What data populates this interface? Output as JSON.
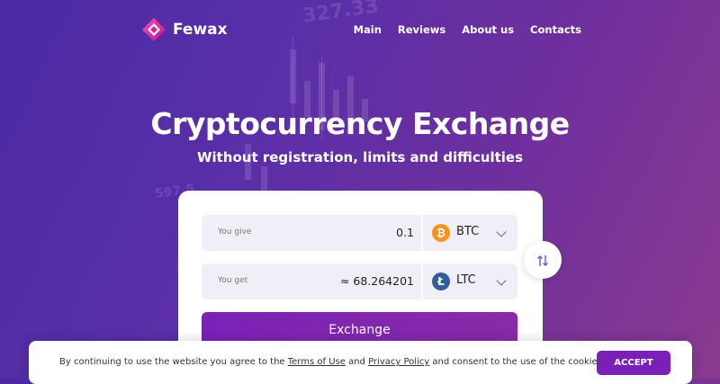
{
  "brand": {
    "name": "Fewax"
  },
  "nav": {
    "items": [
      "Main",
      "Reviews",
      "About us",
      "Contacts"
    ]
  },
  "background": {
    "numbers": [
      "327.33",
      "597.5"
    ]
  },
  "hero": {
    "title": "Cryptocurrency Exchange",
    "subtitle": "Without registration, limits and difficulties"
  },
  "exchange": {
    "give": {
      "label": "You give",
      "amount": "0.1",
      "currency": "BTC",
      "icon": "bitcoin-icon",
      "icon_glyph": "₿",
      "color": "#f7931a"
    },
    "get": {
      "label": "You get",
      "amount": "≈ 68.264201",
      "currency": "LTC",
      "icon": "litecoin-icon",
      "icon_glyph": "Ł",
      "color": "#345d9d"
    },
    "swap_icon": "swap-arrows-icon",
    "button_label": "Exchange"
  },
  "cookie": {
    "text_before": "By continuing to use the website you agree to the ",
    "terms_link": "Terms of Use",
    "text_and": " and ",
    "privacy_link": "Privacy Policy",
    "text_after": " and consent to the use of the cookies.",
    "accept_label": "ACCEPT"
  },
  "colors": {
    "accent": "#7a1fb8",
    "background_start": "#4b2aa6",
    "background_end": "#8a3a8f"
  }
}
